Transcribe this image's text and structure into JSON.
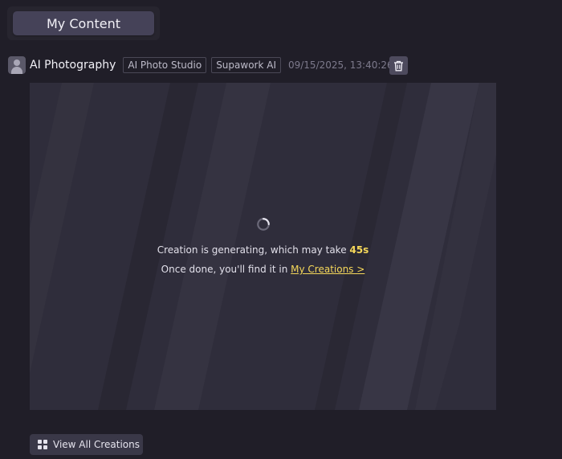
{
  "tabs": {
    "active_label": "My Content"
  },
  "item": {
    "title": "AI Photography",
    "tags": [
      "AI Photo Studio",
      "Supawork AI"
    ],
    "timestamp": "09/15/2025, 13:40:26",
    "icons": {
      "avatar": "user-avatar-icon",
      "delete": "trash-icon"
    }
  },
  "status": {
    "line1_prefix": "Creation is generating, which may take ",
    "line1_time": "45s",
    "line2_prefix": "Once done, you'll find it in ",
    "line2_link": "My Creations >"
  },
  "footer": {
    "view_all_label": "View All Creations",
    "view_all_icon": "grid-icon"
  },
  "colors": {
    "page_bg": "#201e28",
    "preview_bg": "#2f2d3b",
    "accent_yellow": "#f6d85a"
  }
}
